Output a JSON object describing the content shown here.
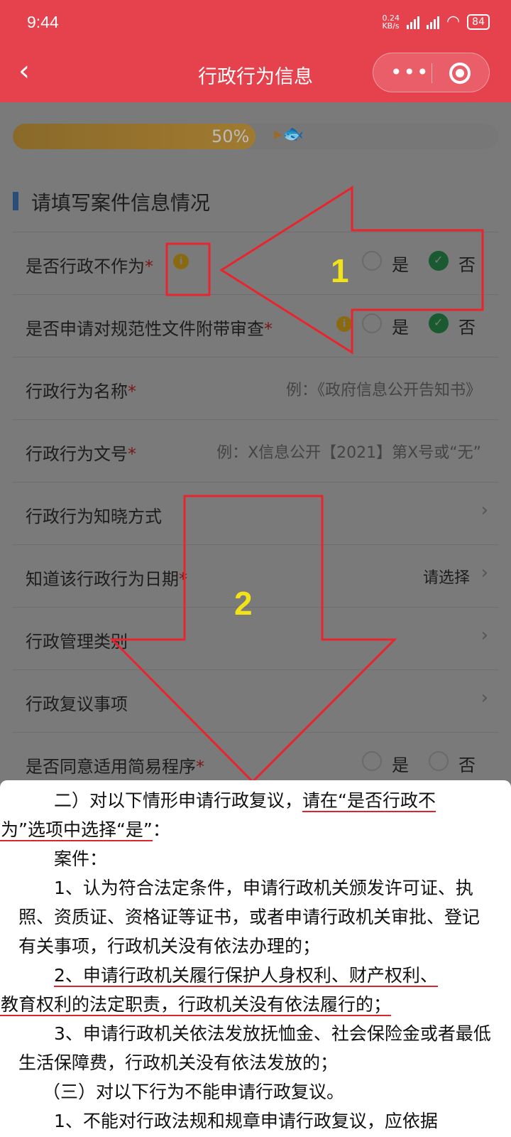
{
  "status_bar": {
    "time": "9:44",
    "net_speed": "0.24\nKB/s",
    "signal1": "HD",
    "signal2": "HD",
    "wifi_badge": "6",
    "battery": "84"
  },
  "navbar": {
    "back_icon": "chevron-left-icon",
    "title": "行政行为信息",
    "more_icon": "more-dots-icon",
    "close_icon": "target-icon"
  },
  "progress": {
    "label": "50%",
    "value": 0.5
  },
  "section_title": "请填写案件信息情况",
  "fields": {
    "inaction": {
      "label": "是否行政不作为",
      "required": "*",
      "yes": "是",
      "no": "否",
      "selected": "否"
    },
    "normative": {
      "label": "是否申请对规范性文件附带审查",
      "required": "*",
      "yes": "是",
      "no": "否",
      "selected": "否"
    },
    "act_name": {
      "label": "行政行为名称",
      "required": "*",
      "placeholder": "例：《政府信息公开告知书》"
    },
    "act_number": {
      "label": "行政行为文号",
      "required": "*",
      "placeholder": "例：X信息公开【2021】第X号或“无”"
    },
    "know_way": {
      "label": "行政行为知晓方式"
    },
    "know_date": {
      "label": "知道该行政行为日期",
      "required": "*",
      "value": "请选择"
    },
    "mgmt_type": {
      "label": "行政管理类别"
    },
    "review_item": {
      "label": "行政复议事项"
    },
    "simple_proc": {
      "label": "是否同意适用简易程序",
      "required": "*",
      "yes": "是",
      "no": "否"
    }
  },
  "annotations": {
    "marker1": "1",
    "marker2": "2",
    "color": "#e8252f"
  },
  "document": {
    "p1a": "二）对以下情形申请行政复议，",
    "p1b": "请在“是否行政不",
    "p1c": "作为”选项中选择“是”",
    "p1d": "：",
    "p2": "案件：",
    "p3": "1、认为符合法定条件，申请行政机关颁发许可证、执照、资质证、资格证等证书，或者申请行政机关审批、登记有关事项，行政机关没有依法办理的；",
    "p4a": "2、申请行政机关履行保护人身权利、财产权利、",
    "p4b": "受教育权利的法定职责，行政机关没有依法履行的；",
    "p5": "3、申请行政机关依法发放抚恤金、社会保险金或者最低生活保障费，行政机关没有依法发放的；",
    "p6": "（三）对以下行为不能申请行政复议。",
    "p7": "1、不能对行政法规和规章申请行政复议，应依据"
  }
}
